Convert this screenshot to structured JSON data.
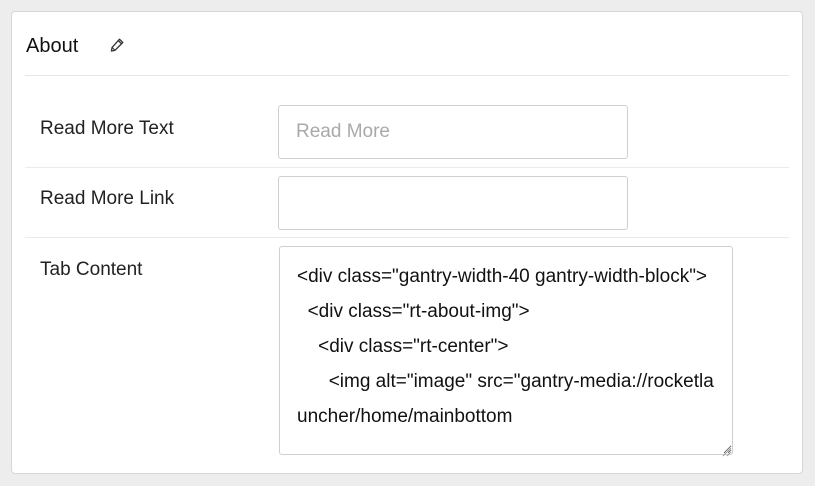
{
  "panel": {
    "title": "About",
    "edit_icon": "pencil-icon"
  },
  "fields": {
    "read_more_text": {
      "label": "Read More Text",
      "value": "",
      "placeholder": "Read More"
    },
    "read_more_link": {
      "label": "Read More Link",
      "value": "",
      "placeholder": ""
    },
    "tab_content": {
      "label": "Tab Content",
      "value": "<div class=\"gantry-width-40 gantry-width-block\">\n  <div class=\"rt-about-img\">\n    <div class=\"rt-center\">\n      <img alt=\"image\" src=\"gantry-media://rocketlauncher/home/mainbottom"
    }
  },
  "colors": {
    "page_background": "#ededed",
    "panel_background": "#ffffff",
    "border": "#cfcfcf",
    "placeholder": "#a9a9a9"
  }
}
